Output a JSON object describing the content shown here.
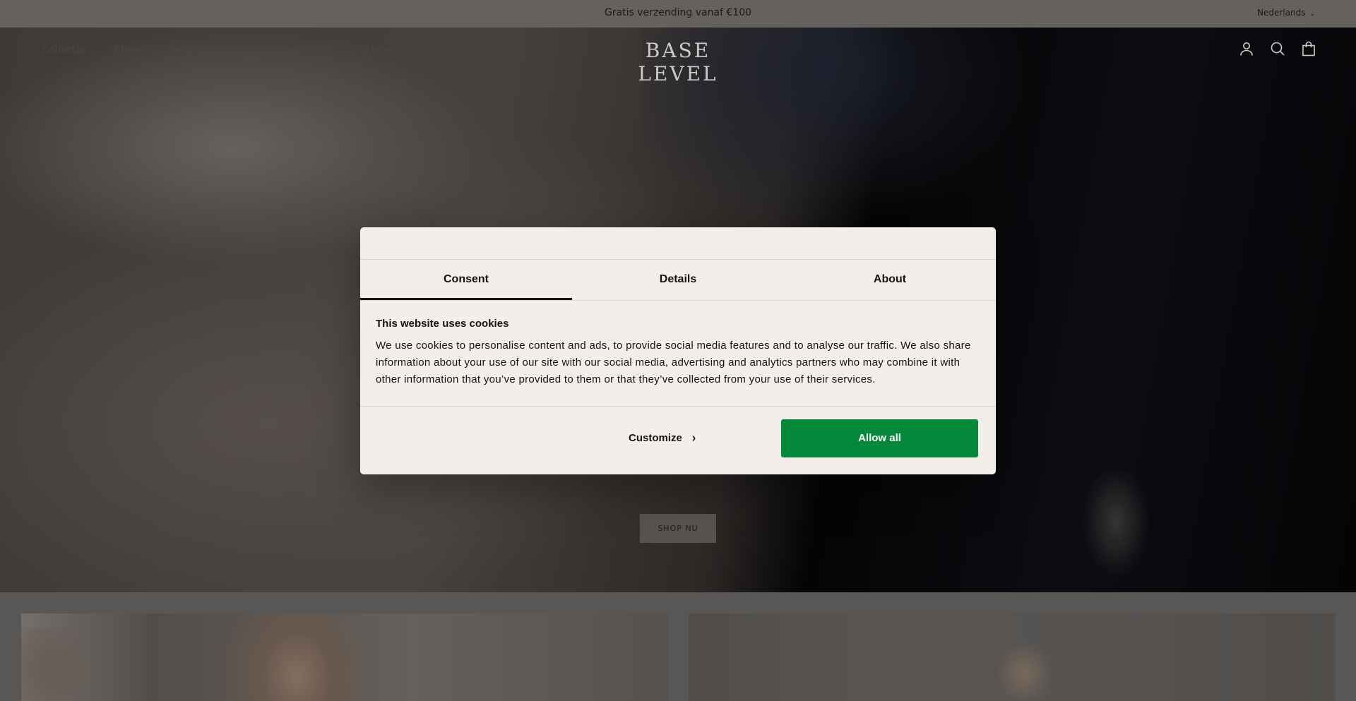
{
  "announcement": {
    "text": "Gratis verzending vanaf €100",
    "language": "Nederlands"
  },
  "header": {
    "logo": "BASE LEVEL",
    "nav": [
      "Collectie",
      "Nieuw",
      "Inspiratie",
      "Base Level Curvy",
      "Stores"
    ],
    "icons": [
      "account-icon",
      "search-icon",
      "bag-icon"
    ]
  },
  "hero": {
    "cta_label": "SHOP NU"
  },
  "cookie_dialog": {
    "tabs": [
      "Consent",
      "Details",
      "About"
    ],
    "active_tab": "Consent",
    "heading": "This website uses cookies",
    "body": "We use cookies to personalise content and ads, to provide social media features and to analyse our traffic. We also share information about your use of our site with our social media, advertising and analytics partners who may combine it with other information that you’ve provided to them or that they’ve collected from your use of their services.",
    "customize_label": "Customize",
    "allow_label": "Allow all",
    "colors": {
      "allow_button": "#038939",
      "background": "#f2eee9"
    }
  }
}
